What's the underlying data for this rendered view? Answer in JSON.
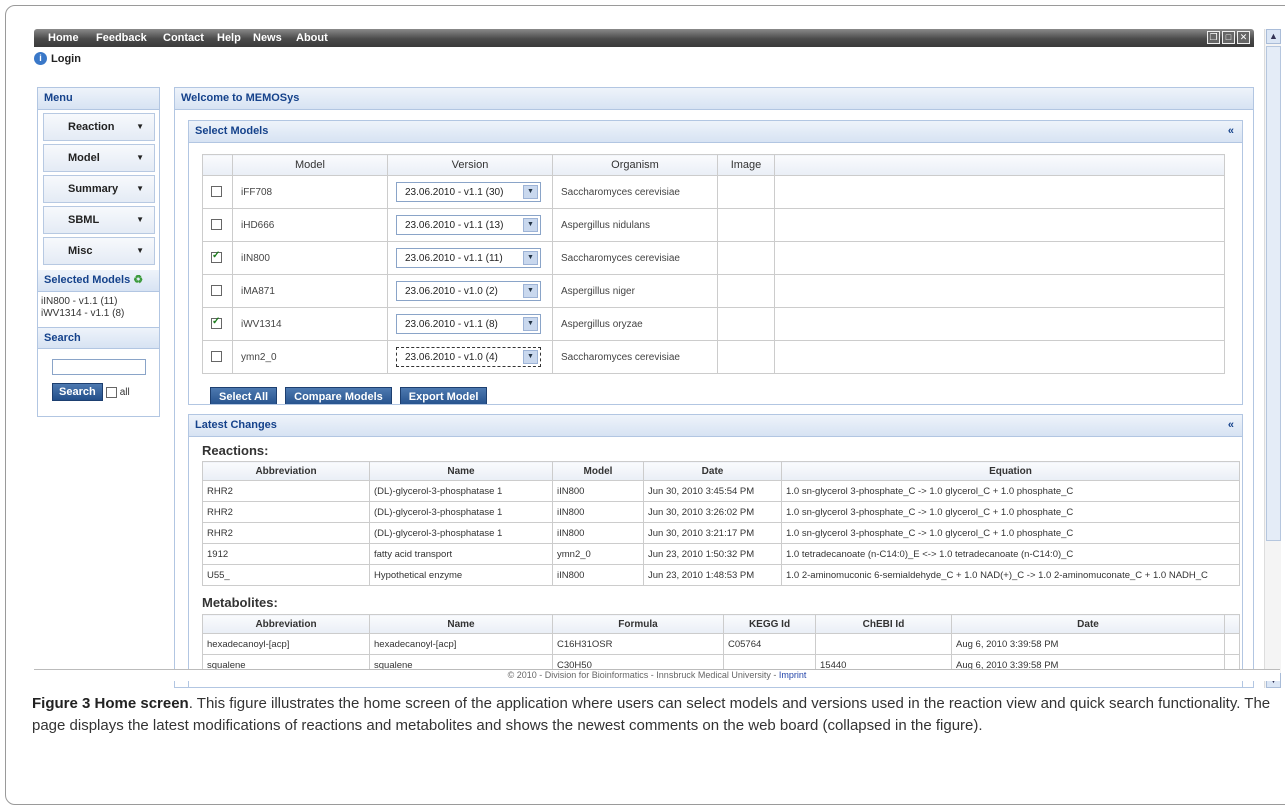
{
  "nav": [
    "Home",
    "Feedback",
    "Contact",
    "Help",
    "News",
    "About"
  ],
  "login": "Login",
  "sidebar": {
    "menu_title": "Menu",
    "items": [
      {
        "label": "Reaction"
      },
      {
        "label": "Model"
      },
      {
        "label": "Summary"
      },
      {
        "label": "SBML"
      },
      {
        "label": "Misc"
      }
    ],
    "selected_title": "Selected Models",
    "selected": [
      "iIN800 - v1.1 (11)",
      "iWV1314 - v1.1 (8)"
    ],
    "search_title": "Search",
    "search_value": "",
    "search_button": "Search",
    "all_label": "all"
  },
  "main": {
    "title": "Welcome to MEMOSys",
    "select_models": {
      "title": "Select Models",
      "collapse": "«",
      "headers": [
        "Model",
        "Version",
        "Organism",
        "Image"
      ],
      "rows": [
        {
          "checked": false,
          "model": "iFF708",
          "version": "23.06.2010 - v1.1 (30)",
          "organism": "Saccharomyces cerevisiae"
        },
        {
          "checked": false,
          "model": "iHD666",
          "version": "23.06.2010 - v1.1 (13)",
          "organism": "Aspergillus nidulans"
        },
        {
          "checked": true,
          "model": "iIN800",
          "version": "23.06.2010 - v1.1 (11)",
          "organism": "Saccharomyces cerevisiae"
        },
        {
          "checked": false,
          "model": "iMA871",
          "version": "23.06.2010 - v1.0 (2)",
          "organism": "Aspergillus niger"
        },
        {
          "checked": true,
          "model": "iWV1314",
          "version": "23.06.2010 - v1.1 (8)",
          "organism": "Aspergillus oryzae"
        },
        {
          "checked": false,
          "model": "ymn2_0",
          "version": "23.06.2010 - v1.0 (4)",
          "organism": "Saccharomyces cerevisiae"
        }
      ],
      "buttons": {
        "select_all": "Select All",
        "compare": "Compare Models",
        "export": "Export Model"
      }
    },
    "latest": {
      "title": "Latest Changes",
      "collapse": "«",
      "reactions_title": "Reactions:",
      "reaction_headers": [
        "Abbreviation",
        "Name",
        "Model",
        "Date",
        "Equation"
      ],
      "reactions": [
        [
          "RHR2",
          "(DL)-glycerol-3-phosphatase 1",
          "iIN800",
          "Jun 30, 2010 3:45:54 PM",
          "1.0 sn-glycerol 3-phosphate_C -> 1.0 glycerol_C + 1.0 phosphate_C"
        ],
        [
          "RHR2",
          "(DL)-glycerol-3-phosphatase 1",
          "iIN800",
          "Jun 30, 2010 3:26:02 PM",
          "1.0 sn-glycerol 3-phosphate_C -> 1.0 glycerol_C + 1.0 phosphate_C"
        ],
        [
          "RHR2",
          "(DL)-glycerol-3-phosphatase 1",
          "iIN800",
          "Jun 30, 2010 3:21:17 PM",
          "1.0 sn-glycerol 3-phosphate_C -> 1.0 glycerol_C + 1.0 phosphate_C"
        ],
        [
          "1912",
          "fatty acid transport",
          "ymn2_0",
          "Jun 23, 2010 1:50:32 PM",
          "1.0 tetradecanoate (n-C14:0)_E <-> 1.0 tetradecanoate (n-C14:0)_C"
        ],
        [
          "U55_",
          "Hypothetical enzyme",
          "iIN800",
          "Jun 23, 2010 1:48:53 PM",
          "1.0 2-aminomuconic 6-semialdehyde_C + 1.0 NAD(+)_C -> 1.0 2-aminomuconate_C + 1.0 NADH_C"
        ]
      ],
      "metabolites_title": "Metabolites:",
      "metabolite_headers": [
        "Abbreviation",
        "Name",
        "Formula",
        "KEGG Id",
        "ChEBI Id",
        "Date"
      ],
      "metabolites": [
        [
          "hexadecanoyl-[acp]",
          "hexadecanoyl-[acp]",
          "C16H31OSR",
          "C05764",
          "",
          "Aug 6, 2010 3:39:58 PM"
        ],
        [
          "squalene",
          "squalene",
          "C30H50",
          "",
          "15440",
          "Aug 6, 2010 3:39:58 PM"
        ]
      ]
    }
  },
  "footer": {
    "text": "© 2010 - Division for Bioinformatics - Innsbruck Medical University - ",
    "link": "Imprint"
  },
  "caption": {
    "label": "Figure 3 Home screen",
    "text": ". This figure illustrates the home screen of the application where users can select models and versions used in the reaction view and quick search functionality. The page displays the latest modifications of reactions and metabolites and shows the newest comments on the web board (collapsed in the figure)."
  },
  "colors": {
    "header_text": "#15428b",
    "button": "#234f8a",
    "border": "#b2c6e2"
  }
}
